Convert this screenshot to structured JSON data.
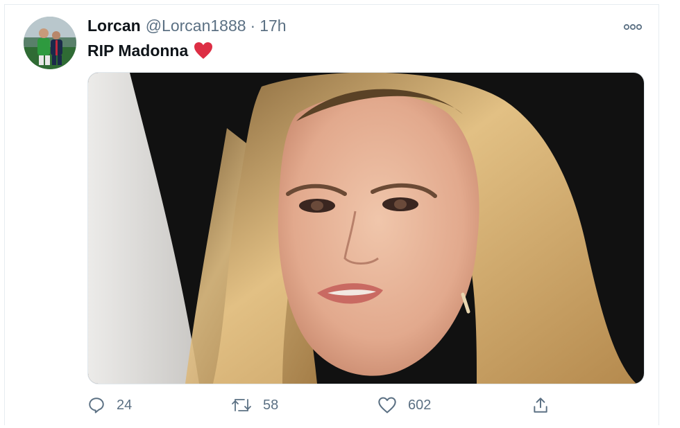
{
  "tweet": {
    "display_name": "Lorcan",
    "handle": "@Lorcan1888",
    "separator": "·",
    "time": "17h",
    "text": "RIP Madonna",
    "emoji": "red-heart",
    "media": {
      "description_icon": "photo"
    },
    "actions": {
      "reply_count": "24",
      "retweet_count": "58",
      "like_count": "602"
    }
  },
  "colors": {
    "text_primary": "#0f1419",
    "text_secondary": "#5b7083",
    "border": "#e6ecf0",
    "heart": "#e0245e"
  }
}
